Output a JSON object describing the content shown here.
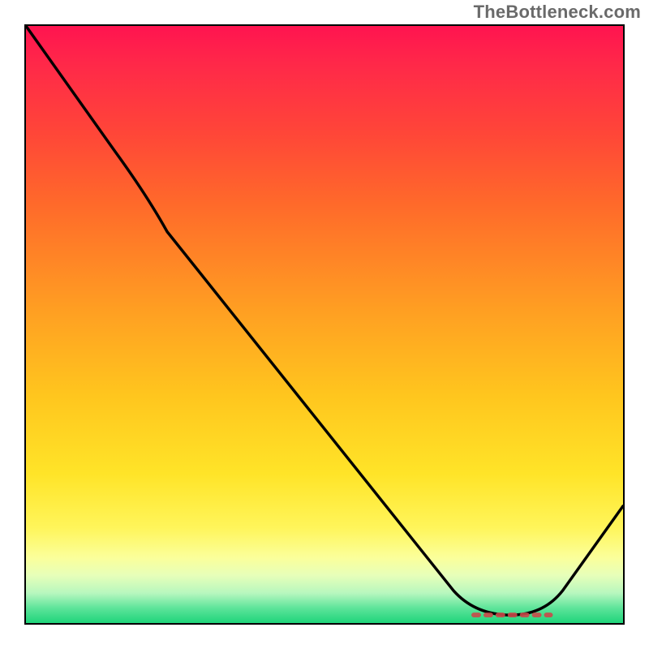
{
  "attribution": "TheBottleneck.com",
  "colors": {
    "border": "#000000",
    "curve": "#000000",
    "marker": "#c94a4a",
    "gradient_top": "#ff1450",
    "gradient_bottom": "#1fd47a",
    "attribution_text": "#6a6a6a"
  },
  "chart_data": {
    "type": "line",
    "title": "",
    "xlabel": "",
    "ylabel": "",
    "x": [
      0.0,
      0.15,
      0.24,
      0.72,
      0.8,
      0.9,
      1.0
    ],
    "values": [
      1.0,
      0.79,
      0.66,
      0.05,
      0.01,
      0.05,
      0.2
    ],
    "xlim": [
      0,
      1
    ],
    "ylim": [
      0,
      1
    ],
    "note": "Axes are unlabeled in the source image; x and y are normalized 0–1. y is plotted with 1 at top, 0 at bottom (higher = worse / red, lower = better / green).",
    "background_gradient": {
      "axis": "y",
      "stops": [
        {
          "pos": 0.0,
          "color": "#1fd47a"
        },
        {
          "pos": 0.05,
          "color": "#b7f7be"
        },
        {
          "pos": 0.11,
          "color": "#fbff9a"
        },
        {
          "pos": 0.25,
          "color": "#ffe428"
        },
        {
          "pos": 0.5,
          "color": "#ffa022"
        },
        {
          "pos": 0.8,
          "color": "#ff4638"
        },
        {
          "pos": 1.0,
          "color": "#ff1450"
        }
      ]
    },
    "marker": {
      "style": "dashed",
      "color": "#c94a4a",
      "x_range": [
        0.75,
        0.88
      ],
      "y": 0.013
    }
  }
}
